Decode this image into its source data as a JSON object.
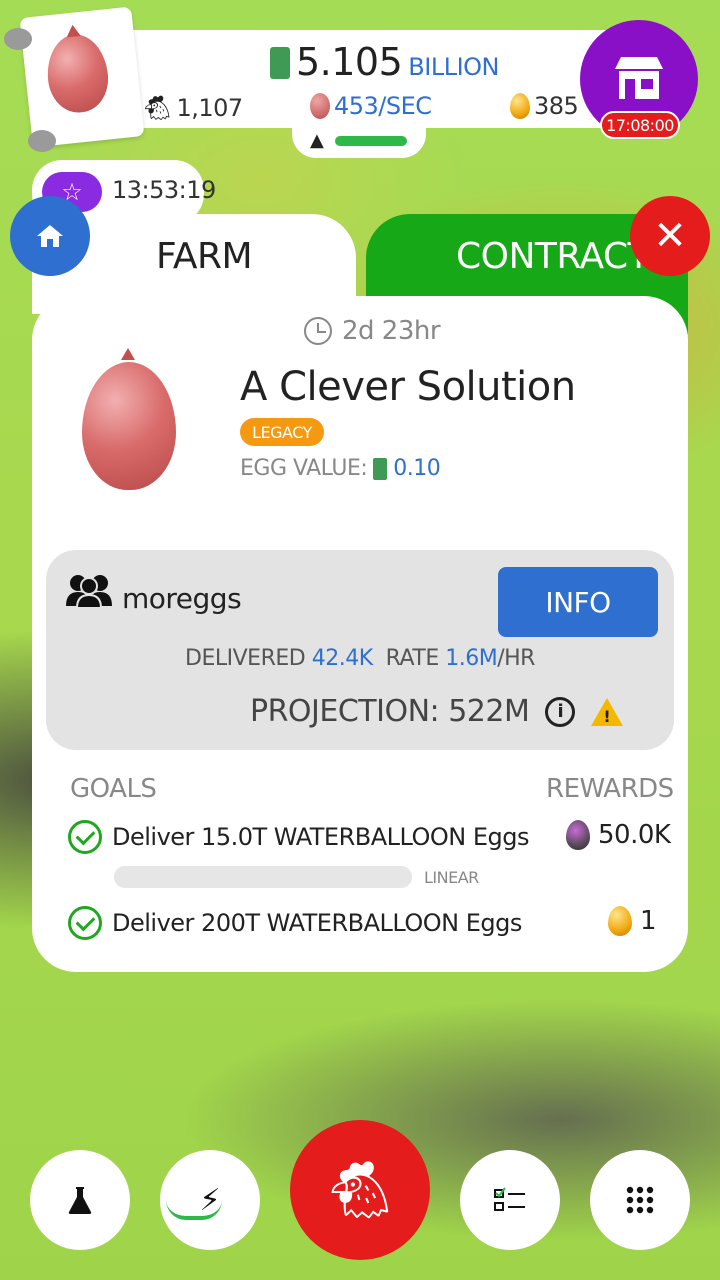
{
  "header": {
    "money_value": "5.105",
    "money_unit": "BILLION",
    "chicken_count": "1,107",
    "egg_rate": "453/SEC",
    "golden_eggs": "385",
    "shop_timer": "17:08:00"
  },
  "event": {
    "timer": "13:53:19"
  },
  "tabs": {
    "farm": "FARM",
    "contracts": "CONTRACTS"
  },
  "contract": {
    "time_left": "2d 23hr",
    "title": "A Clever Solution",
    "badge": "LEGACY",
    "egg_value_label": "EGG VALUE:",
    "egg_value": "0.10"
  },
  "coop": {
    "name": "moreggs",
    "info_label": "INFO",
    "delivered_label": "DELIVERED",
    "delivered_value": "42.4K",
    "rate_label": "RATE",
    "rate_value": "1.6M",
    "rate_unit": "/HR",
    "projection_label": "PROJECTION:",
    "projection_value": "522M"
  },
  "goals": {
    "header": "GOALS",
    "rewards_header": "REWARDS",
    "items": [
      {
        "text": "Deliver 15.0T WATERBALLOON Eggs",
        "reward": "50.0K",
        "reward_icon": "soul-egg-icon"
      },
      {
        "text": "Deliver 200T WATERBALLOON Eggs",
        "reward": "1",
        "reward_icon": "golden-egg-icon"
      }
    ],
    "bar_label": "LINEAR"
  },
  "colors": {
    "accent_blue": "#2e6fcf",
    "contracts_green": "#17a817",
    "close_red": "#e41c1c",
    "shop_purple": "#8a10c8",
    "legacy_orange": "#f59a10"
  }
}
